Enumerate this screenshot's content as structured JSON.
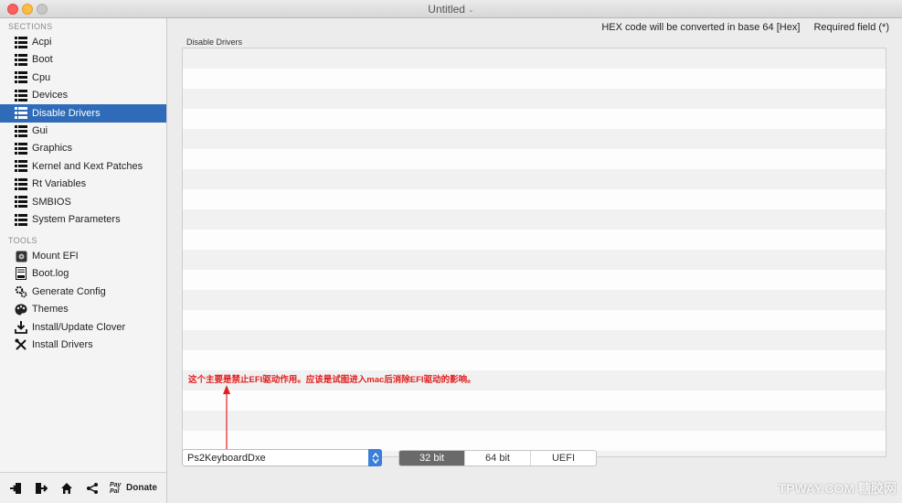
{
  "window": {
    "title": "Untitled"
  },
  "sidebar": {
    "sections_label": "SECTIONS",
    "tools_label": "TOOLS",
    "sections": [
      {
        "label": "Acpi",
        "icon": "list-icon"
      },
      {
        "label": "Boot",
        "icon": "list-icon"
      },
      {
        "label": "Cpu",
        "icon": "list-icon"
      },
      {
        "label": "Devices",
        "icon": "list-icon"
      },
      {
        "label": "Disable Drivers",
        "icon": "list-icon",
        "selected": true
      },
      {
        "label": "Gui",
        "icon": "list-icon"
      },
      {
        "label": "Graphics",
        "icon": "list-icon"
      },
      {
        "label": "Kernel and Kext Patches",
        "icon": "list-icon"
      },
      {
        "label": "Rt Variables",
        "icon": "list-icon"
      },
      {
        "label": "SMBIOS",
        "icon": "list-icon"
      },
      {
        "label": "System Parameters",
        "icon": "list-icon"
      }
    ],
    "tools": [
      {
        "label": "Mount EFI",
        "icon": "disk-icon"
      },
      {
        "label": "Boot.log",
        "icon": "document-icon"
      },
      {
        "label": "Generate Config",
        "icon": "gears-icon"
      },
      {
        "label": "Themes",
        "icon": "palette-icon"
      },
      {
        "label": "Install/Update Clover",
        "icon": "download-icon"
      },
      {
        "label": "Install Drivers",
        "icon": "tools-icon"
      }
    ],
    "donate_label": "Donate",
    "paypal_label": "Pay Pal"
  },
  "main": {
    "hex_note": "HEX code will be converted in base 64 [Hex]",
    "required_note": "Required field (*)",
    "group_label": "Disable Drivers",
    "annotation": "这个主要是禁止EFI驱动作用。应该是试图进入mac后消除EFI驱动的影响。",
    "driver_value": "Ps2KeyboardDxe",
    "segments": [
      {
        "label": "32 bit",
        "active": true
      },
      {
        "label": "64 bit",
        "active": false
      },
      {
        "label": "UEFI",
        "active": false
      }
    ]
  },
  "watermark": "TPWAY.COM 糖胶网",
  "colors": {
    "selection": "#2f6bb8",
    "annotation": "#e02020",
    "stepper": "#3a7ed9"
  }
}
